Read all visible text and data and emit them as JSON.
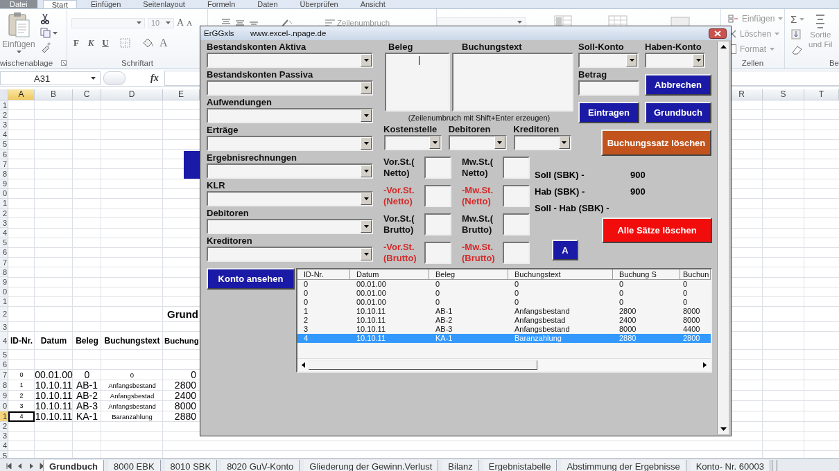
{
  "ribbon_tabs": [
    {
      "label": "Datei",
      "kind": "file",
      "selected": false
    },
    {
      "label": "Start",
      "kind": "tab",
      "selected": true
    },
    {
      "label": "Einfügen",
      "kind": "tab",
      "selected": false
    },
    {
      "label": "Seitenlayout",
      "kind": "tab",
      "selected": false
    },
    {
      "label": "Formeln",
      "kind": "tab",
      "selected": false
    },
    {
      "label": "Daten",
      "kind": "tab",
      "selected": false
    },
    {
      "label": "Überprüfen",
      "kind": "tab",
      "selected": false
    },
    {
      "label": "Ansicht",
      "kind": "tab",
      "selected": false
    }
  ],
  "ribbon": {
    "paste_label": "Einfügen",
    "clipboard_group": "wischenablage",
    "font_size": "10",
    "font_grow": "A",
    "font_shrink": "A",
    "bold": "F",
    "italic": "K",
    "underline": "U",
    "font_color": "A",
    "font_group": "Schriftart",
    "wrap_label": "Zeilenumbruch",
    "cell_commands": [
      "Einfügen",
      "Löschen",
      "Format"
    ],
    "cells_group": "Zellen",
    "sum": "Σ",
    "sort_lines": [
      "Sortie",
      "und Fil"
    ],
    "editing_group": "Be"
  },
  "name_box": "A31",
  "formula_label": "fx",
  "sheet": {
    "columns": [
      {
        "label": "A",
        "selected": true
      },
      {
        "label": "B",
        "selected": false
      },
      {
        "label": "C",
        "selected": false
      },
      {
        "label": "D",
        "selected": false
      },
      {
        "label": "E",
        "selected": false
      },
      {
        "label": "R",
        "selected": false
      },
      {
        "label": "S",
        "selected": false
      },
      {
        "label": "T",
        "selected": false
      }
    ],
    "rows": [
      {
        "number": "1",
        "kind": "plain",
        "selected": false
      },
      {
        "number": "2",
        "kind": "plain",
        "selected": false
      },
      {
        "number": "3",
        "kind": "plain",
        "selected": false
      },
      {
        "number": "4",
        "kind": "plain",
        "selected": false
      },
      {
        "number": "5",
        "kind": "plain",
        "selected": false
      },
      {
        "number": "6",
        "kind": "plain",
        "selected": false
      },
      {
        "number": "7",
        "kind": "plain",
        "selected": false
      },
      {
        "number": "8",
        "kind": "plain",
        "selected": false
      },
      {
        "number": "9",
        "kind": "plain",
        "selected": false
      },
      {
        "number": "0",
        "kind": "plain",
        "selected": false
      },
      {
        "number": "1",
        "kind": "plain",
        "selected": false
      },
      {
        "number": "2",
        "kind": "plain",
        "selected": false
      },
      {
        "number": "3",
        "kind": "plain",
        "selected": false
      },
      {
        "number": "4",
        "kind": "plain",
        "selected": false
      },
      {
        "number": "5",
        "kind": "plain",
        "selected": false
      },
      {
        "number": "6",
        "kind": "plain",
        "selected": false
      },
      {
        "number": "7",
        "kind": "plain",
        "selected": false
      },
      {
        "number": "8",
        "kind": "plain",
        "selected": false
      },
      {
        "number": "9",
        "kind": "plain",
        "selected": false
      },
      {
        "number": "0",
        "kind": "plain",
        "selected": false
      },
      {
        "number": "1",
        "kind": "plain",
        "selected": false
      },
      {
        "number": "2",
        "kind": "title",
        "selected": false,
        "cells": {
          "e": "Grund"
        }
      },
      {
        "number": "3",
        "kind": "plain",
        "selected": false
      },
      {
        "number": "4",
        "kind": "header",
        "selected": false,
        "cells": {
          "a": "ID-Nr.",
          "b": "Datum",
          "c": "Beleg",
          "d": "Buchungstext",
          "e": "Buchung"
        }
      },
      {
        "number": "5",
        "kind": "plain",
        "selected": false
      },
      {
        "number": "6",
        "kind": "plain",
        "selected": false
      },
      {
        "number": "7",
        "kind": "data",
        "selected": false,
        "cells": {
          "a": "0",
          "b": "00.01.00",
          "c": "0",
          "d": "0",
          "e": "0"
        }
      },
      {
        "number": "8",
        "kind": "data",
        "selected": false,
        "cells": {
          "a": "1",
          "b": "10.10.11",
          "c": "AB-1",
          "d": "Anfangsbestand",
          "e": "2800"
        }
      },
      {
        "number": "9",
        "kind": "data",
        "selected": false,
        "cells": {
          "a": "2",
          "b": "10.10.11",
          "c": "AB-2",
          "d": "Anfangsbestad",
          "e": "2400"
        }
      },
      {
        "number": "0",
        "kind": "data",
        "selected": false,
        "cells": {
          "a": "3",
          "b": "10.10.11",
          "c": "AB-3",
          "d": "Anfangsbestand",
          "e": "8000"
        }
      },
      {
        "number": "1",
        "kind": "data",
        "selected": true,
        "cells": {
          "a": "4",
          "b": "10.10.11",
          "c": "KA-1",
          "d": "Baranzahlung",
          "e": "2880"
        }
      },
      {
        "number": "2",
        "kind": "plain",
        "selected": false
      },
      {
        "number": "3",
        "kind": "plain",
        "selected": false
      },
      {
        "number": "4",
        "kind": "plain",
        "selected": false
      },
      {
        "number": "5",
        "kind": "plain",
        "selected": false
      }
    ]
  },
  "sheet_tabs": [
    {
      "label": "Grundbuch",
      "selected": true
    },
    {
      "label": "8000 EBK",
      "selected": false
    },
    {
      "label": "8010 SBK",
      "selected": false
    },
    {
      "label": "8020 GuV-Konto",
      "selected": false
    },
    {
      "label": "Gliederung der Gewinn.Verlust",
      "selected": false
    },
    {
      "label": "Bilanz",
      "selected": false
    },
    {
      "label": "Ergebnistabelle",
      "selected": false
    },
    {
      "label": "Abstimmung der Ergebnisse",
      "selected": false
    },
    {
      "label": "Konto- Nr. 60003",
      "selected": false
    }
  ],
  "dialog": {
    "title": "ErGGxls",
    "subtitle": "www.excel-.npage.de",
    "account_combos": [
      {
        "label": "Bestandskonten Aktiva"
      },
      {
        "label": "Bestandskonten Passiva"
      },
      {
        "label": "Aufwendungen"
      },
      {
        "label": "Erträge"
      },
      {
        "label": "Ergebnisrechnungen"
      },
      {
        "label": "KLR"
      },
      {
        "label": "Debitoren"
      },
      {
        "label": "Kreditoren"
      }
    ],
    "beleg_label": "Beleg",
    "beleg_focused": true,
    "text_label": "Buchungstext",
    "hint": "(Zeilenumbruch mit Shift+Enter erzeugen)",
    "small_combos": [
      {
        "label": "Kostenstelle"
      },
      {
        "label": "Debitoren"
      },
      {
        "label": "Kreditoren"
      }
    ],
    "soll_label": "Soll-Konto",
    "haben_label": "Haben-Konto",
    "betrag_label": "Betrag",
    "buttons": {
      "cancel": {
        "label": "Abbrechen",
        "kind": "standard"
      },
      "enter": {
        "label": "Eintragen",
        "kind": "standard"
      },
      "ledger": {
        "label": "Grundbuch",
        "kind": "standard"
      },
      "delete_entry": {
        "label": "Buchungssatz löschen",
        "kind": "caution"
      },
      "delete_all": {
        "label": "Alle Sätze löschen",
        "kind": "danger"
      },
      "a": {
        "label": "A",
        "kind": "standard"
      },
      "view_account": {
        "label": "Konto ansehen",
        "kind": "standard"
      }
    },
    "tax_fields": [
      {
        "lines": [
          "Vor.St.(",
          "Netto)"
        ],
        "negative": false
      },
      {
        "lines": [
          "Mw.St.(",
          "Netto)"
        ],
        "negative": false
      },
      {
        "lines": [
          "-Vor.St.",
          "(Netto)"
        ],
        "negative": true
      },
      {
        "lines": [
          "-Mw.St.",
          "(Netto)"
        ],
        "negative": true
      },
      {
        "lines": [
          "Vor.St.(",
          "Brutto)"
        ],
        "negative": false
      },
      {
        "lines": [
          "Mw.St.(",
          "Brutto)"
        ],
        "negative": false
      },
      {
        "lines": [
          "-Vor.St.",
          "(Brutto)"
        ],
        "negative": true
      },
      {
        "lines": [
          "-Mw.St.",
          "(Brutto)"
        ],
        "negative": true
      }
    ],
    "totals": [
      {
        "label": "Soll (SBK) -",
        "value": "900"
      },
      {
        "label": "Hab (SBK) -",
        "value": "900"
      },
      {
        "label": "Soll - Hab (SBK) -"
      }
    ],
    "list": {
      "columns": [
        "ID-Nr.",
        "Datum",
        "Beleg",
        "Buchungstext",
        "Buchung S",
        "Buchun"
      ],
      "rows": [
        {
          "cells": [
            "0",
            "00.01.00",
            "0",
            "0",
            "0",
            "0"
          ],
          "selected": false
        },
        {
          "cells": [
            "0",
            "00.01.00",
            "0",
            "0",
            "0",
            "0"
          ],
          "selected": false
        },
        {
          "cells": [
            "0",
            "00.01.00",
            "0",
            "0",
            "0",
            "0"
          ],
          "selected": false
        },
        {
          "cells": [
            "1",
            "10.10.11",
            "AB-1",
            "Anfangsbestand",
            "2800",
            "8000"
          ],
          "selected": false
        },
        {
          "cells": [
            "2",
            "10.10.11",
            "AB-2",
            "Anfangsbestad",
            "2400",
            "8000"
          ],
          "selected": false
        },
        {
          "cells": [
            "3",
            "10.10.11",
            "AB-3",
            "Anfangsbestand",
            "8000",
            "4400"
          ],
          "selected": false
        },
        {
          "cells": [
            "4",
            "10.10.11",
            "KA-1",
            "Baranzahlung",
            "2880",
            "2800"
          ],
          "selected": true
        }
      ]
    }
  }
}
